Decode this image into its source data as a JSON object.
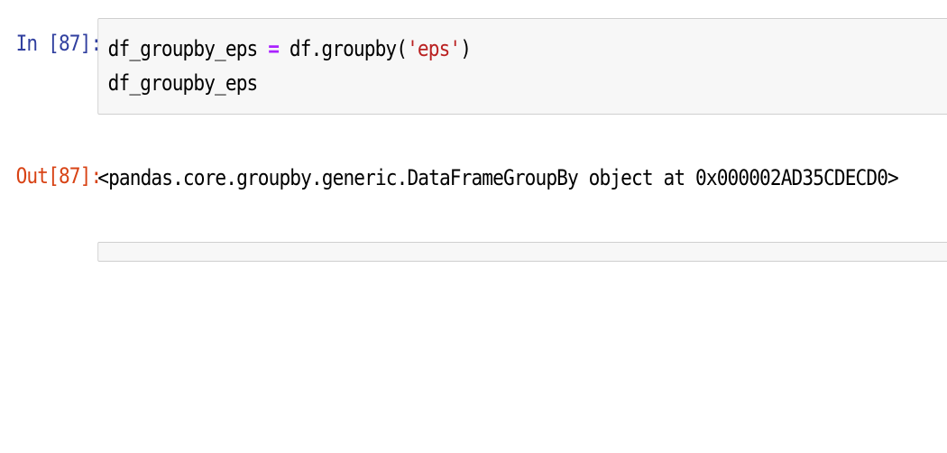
{
  "cells": {
    "in_prompt": "In [87]:",
    "out_prompt": "Out[87]:",
    "code": {
      "line1_a": "df_groupby_eps ",
      "line1_eq": "=",
      "line1_b": " df.groupby(",
      "line1_str": "'eps'",
      "line1_c": ")",
      "line2": "df_groupby_eps"
    },
    "output": "<pandas.core.groupby.generic.DataFrameGroupBy object at 0x000002AD35CDECD0>"
  }
}
